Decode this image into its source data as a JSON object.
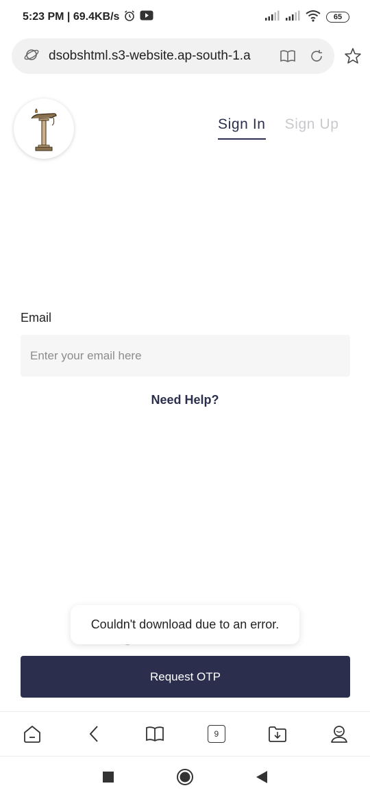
{
  "status_bar": {
    "time_speed": "5:23 PM | 69.4KB/s",
    "battery": "65"
  },
  "browser": {
    "url": "dsobshtml.s3-website.ap-south-1.a",
    "tab_count": "9"
  },
  "header": {
    "tabs": [
      {
        "label": "Sign In",
        "active": true
      },
      {
        "label": "Sign Up",
        "active": false
      }
    ]
  },
  "form": {
    "email_label": "Email",
    "email_placeholder": "Enter your email here",
    "email_value": "",
    "need_help": "Need Help?",
    "phone_link": "Sign In with Phone Number",
    "request_otp": "Request OTP"
  },
  "toast": {
    "message": "Couldn't download due to an error."
  },
  "colors": {
    "primary": "#2b2f4d",
    "input_bg": "#f6f6f6",
    "inactive_tab": "#c9c9cd"
  }
}
